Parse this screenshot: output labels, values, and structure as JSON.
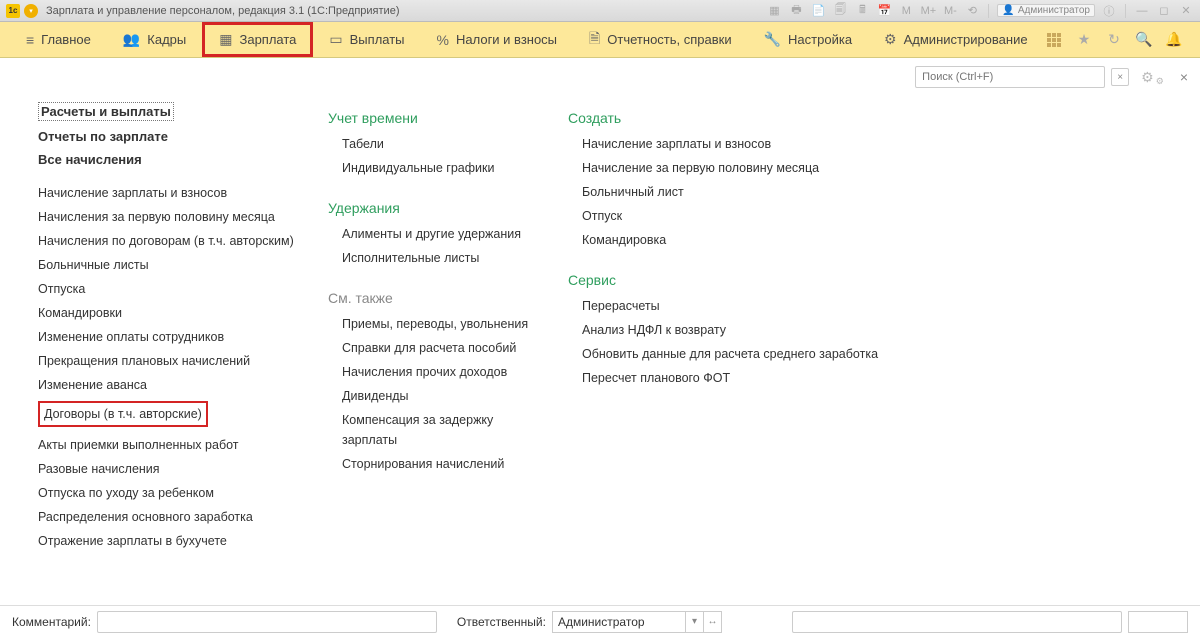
{
  "titlebar": {
    "title": "Зарплата и управление персоналом, редакция 3.1  (1С:Предприятие)",
    "m_text": "M",
    "mplus": "M+",
    "mminus": "M-",
    "admin": "Администратор"
  },
  "nav": {
    "items": [
      {
        "label": "Главное"
      },
      {
        "label": "Кадры"
      },
      {
        "label": "Зарплата"
      },
      {
        "label": "Выплаты"
      },
      {
        "label": "Налоги и взносы"
      },
      {
        "label": "Отчетность, справки"
      },
      {
        "label": "Настройка"
      },
      {
        "label": "Администрирование"
      }
    ]
  },
  "search": {
    "placeholder": "Поиск (Ctrl+F)"
  },
  "col1": {
    "top": [
      "Расчеты и выплаты",
      "Отчеты по зарплате",
      "Все начисления"
    ],
    "links": [
      "Начисление зарплаты и взносов",
      "Начисления за первую половину месяца",
      "Начисления по договорам (в т.ч. авторским)",
      "Больничные листы",
      "Отпуска",
      "Командировки",
      "Изменение оплаты сотрудников",
      "Прекращения плановых начислений",
      "Изменение аванса",
      "Договоры (в т.ч. авторские)",
      "Акты приемки выполненных работ",
      "Разовые начисления",
      "Отпуска по уходу за ребенком",
      "Распределения основного заработка",
      "Отражение зарплаты в бухучете"
    ]
  },
  "col2": {
    "sec1": {
      "title": "Учет времени",
      "links": [
        "Табели",
        "Индивидуальные графики"
      ]
    },
    "sec2": {
      "title": "Удержания",
      "links": [
        "Алименты и другие удержания",
        "Исполнительные листы"
      ]
    },
    "sec3": {
      "title": "См. также",
      "links": [
        "Приемы, переводы, увольнения",
        "Справки для расчета пособий",
        "Начисления прочих доходов",
        "Дивиденды",
        "Компенсация за задержку зарплаты",
        "Сторнирования начислений"
      ]
    }
  },
  "col3": {
    "sec1": {
      "title": "Создать",
      "links": [
        "Начисление зарплаты и взносов",
        "Начисление за первую половину месяца",
        "Больничный лист",
        "Отпуск",
        "Командировка"
      ]
    },
    "sec2": {
      "title": "Сервис",
      "links": [
        "Перерасчеты",
        "Анализ НДФЛ к возврату",
        "Обновить данные для расчета среднего заработка",
        "Пересчет планового ФОТ"
      ]
    }
  },
  "footer": {
    "comment_label": "Комментарий:",
    "resp_label": "Ответственный:",
    "resp_value": "Администратор"
  }
}
